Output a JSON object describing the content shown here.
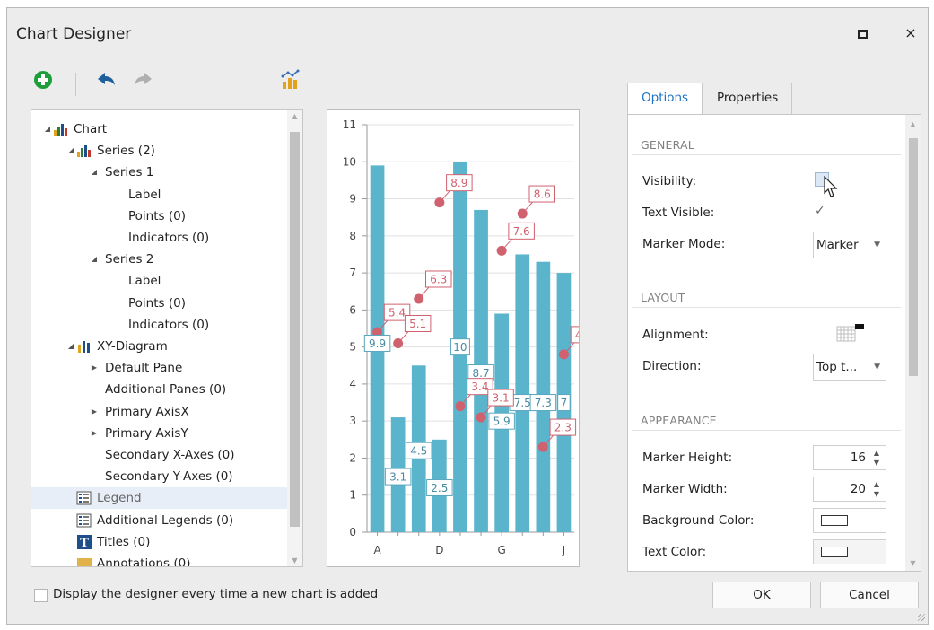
{
  "window": {
    "title": "Chart Designer",
    "maximize_icon": "maximize-icon",
    "close_label": "×"
  },
  "toolbar": {
    "add_icon": "plus-circle-icon",
    "undo_icon": "undo-arrow-icon",
    "redo_icon": "redo-arrow-icon",
    "wizard_icon": "chart-wizard-icon",
    "colors": {
      "add": "#1e9e3a",
      "undo": "#1f5f9e",
      "redo_disabled": "#b0b0b0",
      "wizard": "#e2a21b"
    }
  },
  "tree": {
    "items": [
      {
        "label": "Chart",
        "level": 0,
        "expander": "expanded",
        "icon": "bar-chart-icon"
      },
      {
        "label": "Series (2)",
        "level": 1,
        "expander": "expanded",
        "icon": "series-icon"
      },
      {
        "label": "Series 1",
        "level": 2,
        "expander": "expanded",
        "icon": ""
      },
      {
        "label": "Label",
        "level": 3,
        "expander": "",
        "icon": ""
      },
      {
        "label": "Points (0)",
        "level": 3,
        "expander": "",
        "icon": ""
      },
      {
        "label": "Indicators (0)",
        "level": 3,
        "expander": "",
        "icon": ""
      },
      {
        "label": "Series 2",
        "level": 2,
        "expander": "expanded",
        "icon": ""
      },
      {
        "label": "Label",
        "level": 3,
        "expander": "",
        "icon": ""
      },
      {
        "label": "Points (0)",
        "level": 3,
        "expander": "",
        "icon": ""
      },
      {
        "label": "Indicators (0)",
        "level": 3,
        "expander": "",
        "icon": ""
      },
      {
        "label": "XY-Diagram",
        "level": 1,
        "expander": "expanded",
        "icon": "xy-diagram-icon"
      },
      {
        "label": "Default Pane",
        "level": 2,
        "expander": "collapsed",
        "icon": ""
      },
      {
        "label": "Additional Panes (0)",
        "level": 2,
        "expander": "",
        "icon": ""
      },
      {
        "label": "Primary AxisX",
        "level": 2,
        "expander": "collapsed",
        "icon": ""
      },
      {
        "label": "Primary AxisY",
        "level": 2,
        "expander": "collapsed",
        "icon": ""
      },
      {
        "label": "Secondary X-Axes (0)",
        "level": 2,
        "expander": "",
        "icon": ""
      },
      {
        "label": "Secondary Y-Axes (0)",
        "level": 2,
        "expander": "",
        "icon": ""
      },
      {
        "label": "Legend",
        "level": 1,
        "expander": "",
        "icon": "legend-icon",
        "selected": true
      },
      {
        "label": "Additional Legends (0)",
        "level": 1,
        "expander": "",
        "icon": "legend-icon"
      },
      {
        "label": "Titles (0)",
        "level": 1,
        "expander": "",
        "icon": "title-icon"
      },
      {
        "label": "Annotations (0)",
        "level": 1,
        "expander": "",
        "icon": "annotation-icon"
      }
    ],
    "scroll_fraction": 0.0
  },
  "chart_data": {
    "type": "bar",
    "x": [
      "A",
      "B",
      "C",
      "D",
      "E",
      "F",
      "G",
      "H",
      "I",
      "J"
    ],
    "x_tick_labels": [
      "A",
      "D",
      "G",
      "J"
    ],
    "ylim": [
      0,
      11
    ],
    "y_ticks": [
      0,
      1,
      2,
      3,
      4,
      5,
      6,
      7,
      8,
      9,
      10,
      11
    ],
    "grid": true,
    "legend": "none",
    "series": [
      {
        "kind": "bar",
        "color": "#5ab4cc",
        "label_border": "#5aa7bf",
        "values": [
          9.9,
          3.1,
          4.5,
          2.5,
          10,
          8.7,
          5.9,
          7.5,
          7.3,
          7
        ]
      },
      {
        "kind": "point",
        "color": "#d0616f",
        "label_border": "#d0616f",
        "values": [
          5.4,
          5.1,
          6.3,
          8.9,
          3.4,
          3.1,
          7.6,
          8.6,
          2.3,
          4.8
        ]
      }
    ]
  },
  "properties": {
    "tabs": [
      {
        "label": "Options",
        "active": true
      },
      {
        "label": "Properties",
        "active": false
      }
    ],
    "sections": {
      "general": "GENERAL",
      "layout": "LAYOUT",
      "appearance": "APPEARANCE"
    },
    "visibility_label": "Visibility:",
    "visibility_checked": false,
    "text_visible_label": "Text Visible:",
    "text_visible_checked": true,
    "marker_mode_label": "Marker Mode:",
    "marker_mode_value": "Marker",
    "alignment_label": "Alignment:",
    "alignment_icon": "alignment-grid-icon",
    "direction_label": "Direction:",
    "direction_value": "Top t...",
    "marker_height_label": "Marker Height:",
    "marker_height_value": "16",
    "marker_width_label": "Marker Width:",
    "marker_width_value": "20",
    "background_color_label": "Background Color:",
    "background_color": "#ffffff",
    "text_color_label": "Text Color:",
    "text_color": "#ffffff",
    "cursor_icon": "mouse-pointer-icon"
  },
  "footer": {
    "checkbox_label": "Display the designer every time a new chart is added",
    "checkbox_checked": false,
    "ok_label": "OK",
    "cancel_label": "Cancel"
  }
}
